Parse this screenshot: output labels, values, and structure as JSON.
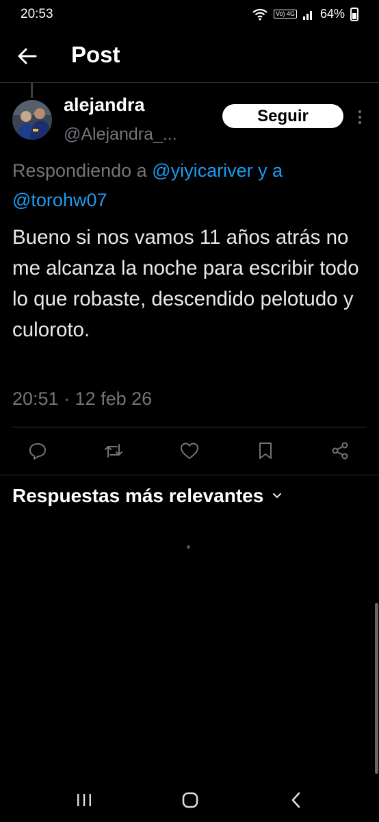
{
  "status_bar": {
    "time": "20:53",
    "network_badge": "Vo) 4G",
    "battery": "64%"
  },
  "header": {
    "title": "Post"
  },
  "post": {
    "author_name": "alejandra",
    "author_handle": "@Alejandra_...",
    "follow_label": "Seguir",
    "reply_prefix": "Respondiendo a ",
    "mention_1": "@yiyicariver",
    "reply_joiner": " y a ",
    "mention_2": "@torohw07",
    "text": "Bueno si nos vamos 11 años atrás no me alcanza la noche para escribir todo lo que robaste, descendido pelotudo y culoroto.",
    "timestamp": "20:51 · 12 feb 26"
  },
  "actions": [
    "reply-icon",
    "repost-icon",
    "like-icon",
    "bookmark-icon",
    "share-icon"
  ],
  "replies": {
    "sort_label": "Respuestas más relevantes"
  },
  "colors": {
    "background": "#000000",
    "text": "#e7e9ea",
    "secondary_text": "#71767b",
    "link": "#1d9bf0",
    "divider": "#2f3336"
  }
}
